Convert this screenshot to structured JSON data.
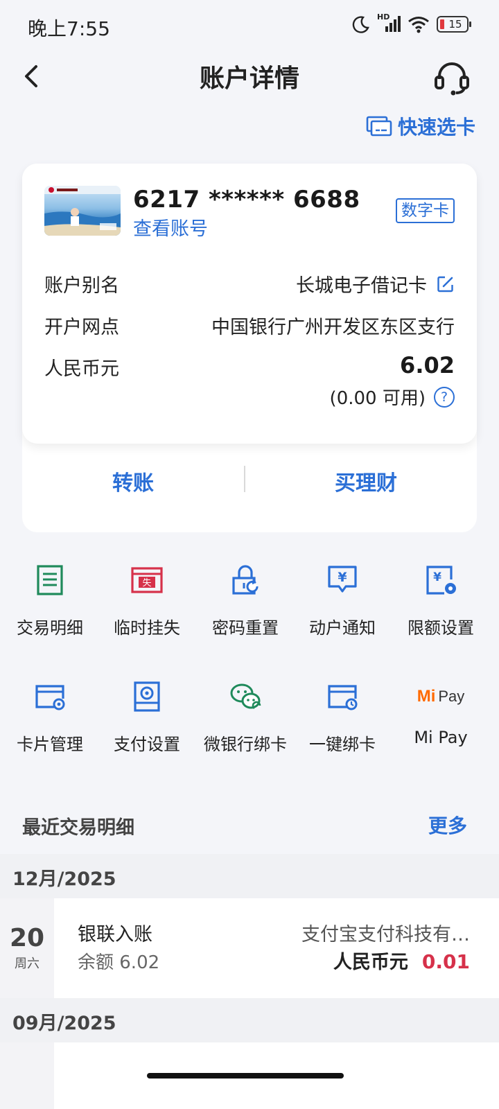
{
  "status_bar": {
    "time": "晚上7:55",
    "network_label": "HD",
    "battery_level": "15",
    "icons": [
      "moon-icon",
      "signal-icon",
      "wifi-icon",
      "battery-icon"
    ]
  },
  "header": {
    "title": "账户详情",
    "back_icon": "chevron-left-icon",
    "support_icon": "headset-icon"
  },
  "quick_select": {
    "label": "快速选卡",
    "icon": "card-select-icon"
  },
  "account": {
    "card_number": "6217 ****** 6688",
    "view_account_label": "查看账号",
    "badge": "数字卡",
    "rows": [
      {
        "label": "账户别名",
        "value": "长城电子借记卡"
      },
      {
        "label": "开户网点",
        "value": "中国银行广州开发区东区支行"
      },
      {
        "label": "人民币元",
        "value": "6.02"
      }
    ],
    "available": "(0.00 可用)",
    "help_symbol": "?",
    "edit_icon": "edit-icon"
  },
  "actions": {
    "transfer": "转账",
    "wealth": "买理财"
  },
  "features": [
    {
      "label": "交易明细",
      "icon": "transaction-list-icon",
      "color": "#1f8a5b"
    },
    {
      "label": "临时挂失",
      "icon": "report-loss-icon",
      "color": "#d6314a",
      "icon_text": "失"
    },
    {
      "label": "密码重置",
      "icon": "password-reset-icon",
      "color": "#2b6fd6"
    },
    {
      "label": "动户通知",
      "icon": "account-notice-icon",
      "color": "#2b6fd6",
      "icon_text": "¥"
    },
    {
      "label": "限额设置",
      "icon": "limit-settings-icon",
      "color": "#2b6fd6",
      "icon_text": "¥"
    },
    {
      "label": "卡片管理",
      "icon": "card-management-icon",
      "color": "#2b6fd6"
    },
    {
      "label": "支付设置",
      "icon": "payment-settings-icon",
      "color": "#2b6fd6"
    },
    {
      "label": "微银行绑卡",
      "icon": "wechat-bind-icon",
      "color": "#1f8a5b"
    },
    {
      "label": "一键绑卡",
      "icon": "quick-bind-icon",
      "color": "#2b6fd6"
    },
    {
      "label": "Mi Pay",
      "icon": "mi-pay-icon",
      "color": "#ff6a00",
      "logo_mi": "Mi",
      "logo_pay": "Pay"
    }
  ],
  "recent": {
    "title": "最近交易明细",
    "more": "更多",
    "groups": [
      {
        "month": "12月/2025",
        "transactions": [
          {
            "day": "20",
            "weekday": "周六",
            "type": "银联入账",
            "balance": "余额 6.02",
            "merchant": "支付宝支付科技有…",
            "currency": "人民币元",
            "amount": "0.01"
          }
        ]
      },
      {
        "month": "09月/2025",
        "transactions": []
      }
    ]
  }
}
